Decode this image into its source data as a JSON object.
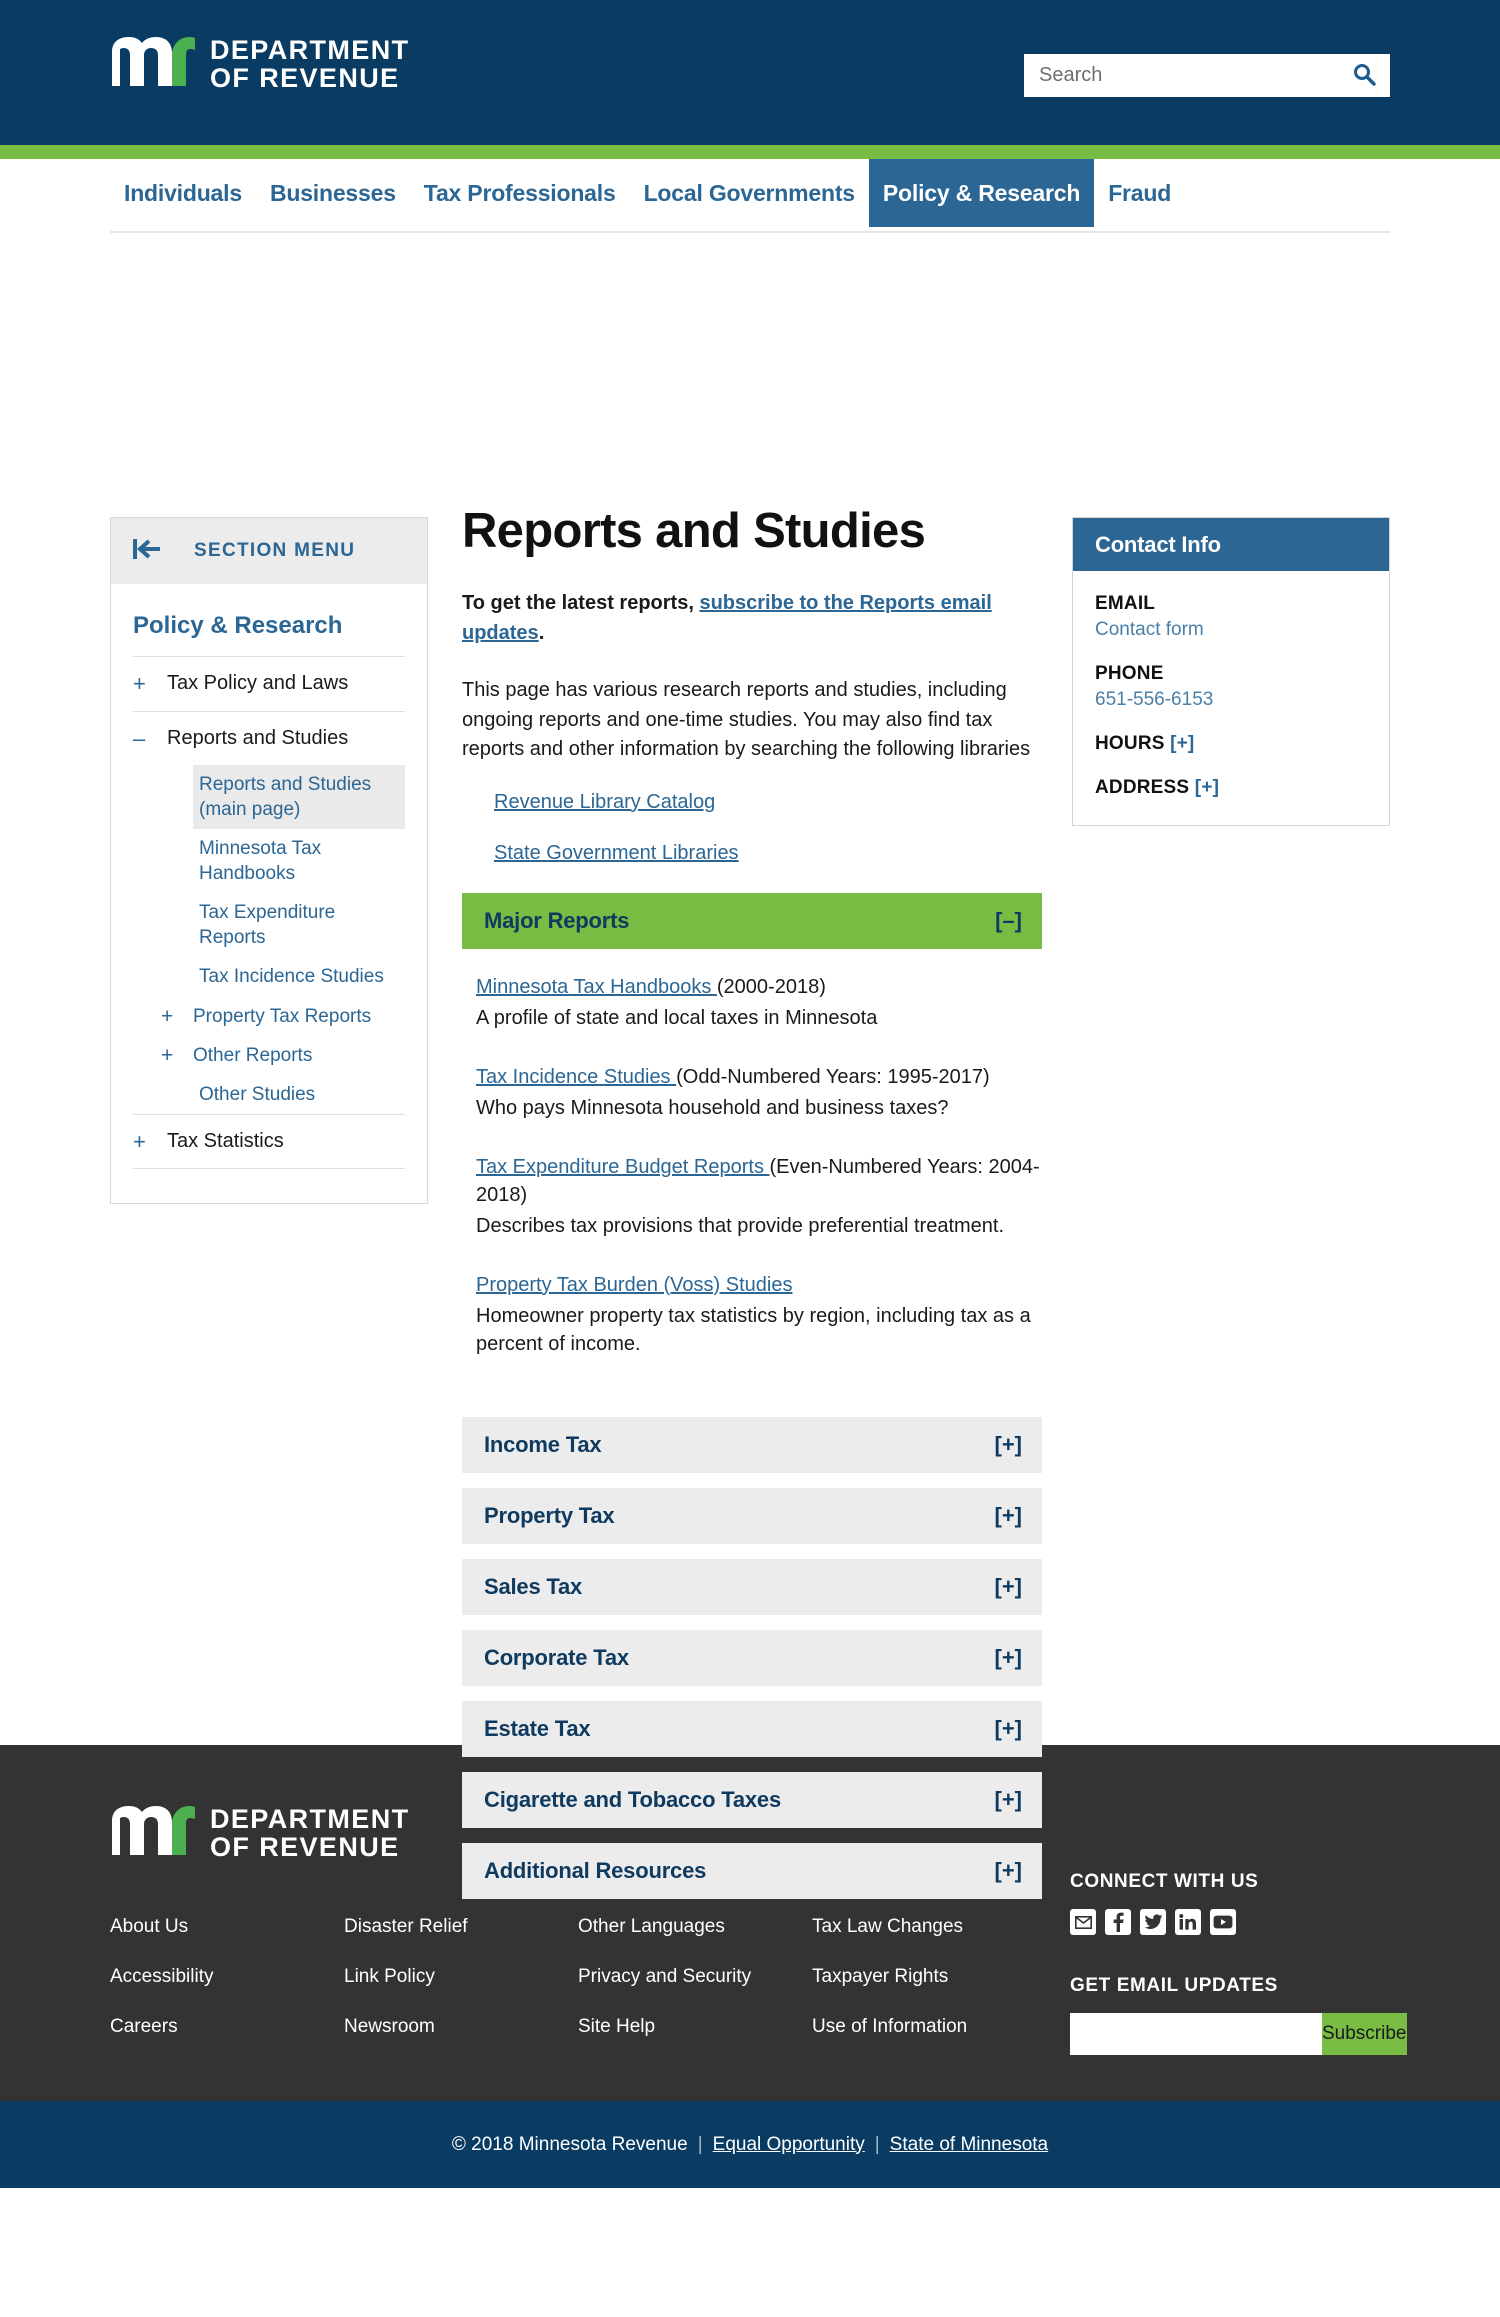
{
  "brand": {
    "logo_line1": "DEPARTMENT",
    "logo_line2": "OF REVENUE",
    "logo_icon": "mn-logo-icon",
    "primary_blue": "#0a3c63",
    "accent_green": "#78bc43",
    "link_blue": "#2b6694"
  },
  "search": {
    "placeholder": "Search",
    "value": "",
    "icon": "search-icon"
  },
  "nav": {
    "items": [
      {
        "label": "Individuals",
        "active": false
      },
      {
        "label": "Businesses",
        "active": false
      },
      {
        "label": "Tax Professionals",
        "active": false
      },
      {
        "label": "Local Governments",
        "active": false
      },
      {
        "label": "Policy & Research",
        "active": true
      },
      {
        "label": "Fraud",
        "active": false
      }
    ]
  },
  "sidebar": {
    "menu_label": "SECTION MENU",
    "collapse_icon": "collapse-left-icon",
    "title": "Policy & Research",
    "items": [
      {
        "toggle": "+",
        "label": "Tax Policy and Laws"
      },
      {
        "toggle": "–",
        "label": "Reports and Studies"
      }
    ],
    "sub_items": [
      {
        "toggle": "",
        "label": "Reports and Studies (main page)",
        "current": true
      },
      {
        "toggle": "",
        "label": "Minnesota Tax Handbooks",
        "current": false
      },
      {
        "toggle": "",
        "label": "Tax Expenditure Reports",
        "current": false
      },
      {
        "toggle": "",
        "label": "Tax Incidence Studies",
        "current": false
      },
      {
        "toggle": "+",
        "label": "Property Tax Reports",
        "current": false
      },
      {
        "toggle": "+",
        "label": "Other Reports",
        "current": false
      },
      {
        "toggle": "",
        "label": "Other Studies",
        "current": false
      }
    ],
    "last_item": {
      "toggle": "+",
      "label": "Tax Statistics"
    }
  },
  "main": {
    "title": "Reports and Studies",
    "lede_prefix": "To get the latest reports, ",
    "lede_link": "subscribe to the Reports email updates",
    "lede_suffix": ".",
    "paragraph": "This page has various research reports and studies, including ongoing reports and one-time studies. You may also find tax reports and other information by searching the following libraries",
    "library_links": [
      "Revenue Library Catalog",
      "State Government Libraries"
    ],
    "major_reports": {
      "heading": "Major Reports",
      "toggle": "[–]",
      "expanded": true,
      "reports": [
        {
          "link": "Minnesota Tax Handbooks ",
          "suffix": "(2000-2018)",
          "desc": "A profile of state and local taxes in Minnesota"
        },
        {
          "link": "Tax Incidence Studies ",
          "suffix": "(Odd-Numbered Years: 1995-2017)",
          "desc": "Who pays Minnesota household and business taxes?"
        },
        {
          "link": "Tax Expenditure Budget Reports ",
          "suffix": "(Even-Numbered Years: 2004-2018)",
          "desc": "Describes tax provisions that provide preferential treatment."
        },
        {
          "link": "Property Tax Burden (Voss) Studies",
          "suffix": "",
          "desc": "Homeowner property tax statistics by region, including tax as a percent of income."
        }
      ]
    },
    "sections": [
      {
        "label": "Income Tax",
        "toggle": "[+]"
      },
      {
        "label": "Property Tax",
        "toggle": "[+]"
      },
      {
        "label": "Sales Tax",
        "toggle": "[+]"
      },
      {
        "label": "Corporate Tax",
        "toggle": "[+]"
      },
      {
        "label": "Estate Tax",
        "toggle": "[+]"
      },
      {
        "label": "Cigarette and Tobacco Taxes",
        "toggle": "[+]"
      },
      {
        "label": "Additional Resources",
        "toggle": "[+]"
      }
    ]
  },
  "contact": {
    "title": "Contact Info",
    "email_label": "EMAIL",
    "email_value": "Contact form",
    "phone_label": "PHONE",
    "phone_value": "651-556-6153",
    "hours_label": "HOURS",
    "hours_toggle": "[+]",
    "address_label": "ADDRESS",
    "address_toggle": "[+]"
  },
  "footer": {
    "columns": [
      {
        "links": [
          "About Us",
          "Accessibility",
          "Careers"
        ]
      },
      {
        "links": [
          "Disaster Relief",
          "Link Policy",
          "Newsroom"
        ]
      },
      {
        "links": [
          "Other Languages",
          "Privacy and Security",
          "Site Help"
        ]
      },
      {
        "links": [
          "Tax Law Changes",
          "Taxpayer Rights",
          "Use of Information"
        ]
      }
    ],
    "connect_title": "CONNECT WITH US",
    "social": [
      {
        "name": "email-icon"
      },
      {
        "name": "facebook-icon"
      },
      {
        "name": "twitter-icon"
      },
      {
        "name": "linkedin-icon"
      },
      {
        "name": "youtube-icon"
      }
    ],
    "updates_title": "GET EMAIL UPDATES",
    "email_placeholder": "",
    "email_value": "",
    "subscribe_label": "Subscribe"
  },
  "copyright": {
    "text": "© 2018 Minnesota Revenue",
    "sep": "|",
    "link1": "Equal Opportunity",
    "link2": "State of Minnesota"
  }
}
